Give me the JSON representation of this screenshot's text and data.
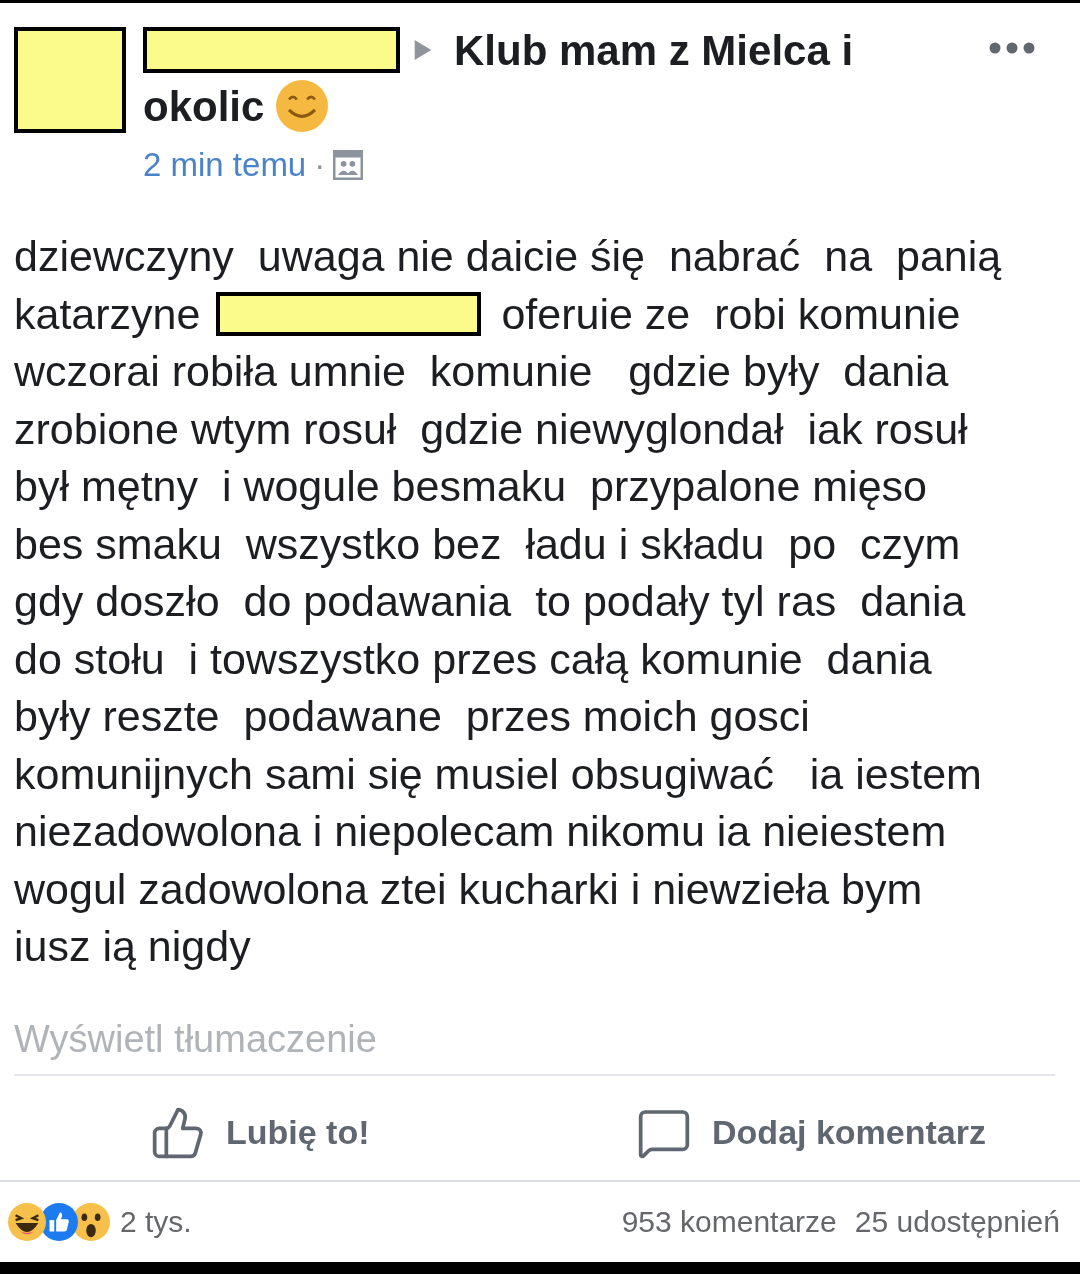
{
  "post": {
    "group_name_lines": [
      "Klub mam z Mielca i",
      "okolic"
    ],
    "timestamp": "2 min temu",
    "separator": "·",
    "body_lines": [
      {
        "kind": "text",
        "text": "dziewczyny  uwaga nie daicie śię  nabrać  na  panią"
      },
      {
        "kind": "redacted",
        "before": "katarzyne",
        "after": "oferuie ze  robi komunie"
      },
      {
        "kind": "text",
        "text": "wczorai robiła umnie  komunie   gdzie były  dania"
      },
      {
        "kind": "text",
        "text": "zrobione wtym rosuł  gdzie niewyglondał  iak rosuł"
      },
      {
        "kind": "text",
        "text": "był mętny  i wogule besmaku  przypalone mięso"
      },
      {
        "kind": "text",
        "text": "bes smaku  wszystko bez  ładu i składu  po  czym"
      },
      {
        "kind": "text",
        "text": "gdy doszło  do podawania  to podały tyl ras  dania"
      },
      {
        "kind": "text",
        "text": "do stołu  i towszystko przes całą komunie  dania"
      },
      {
        "kind": "text",
        "text": "były reszte  podawane  przes moich gosci"
      },
      {
        "kind": "text",
        "text": "komunijnych sami się musiel obsugiwać   ia iestem"
      },
      {
        "kind": "text",
        "text": "niezadowolona i niepolecam nikomu ia nieiestem"
      },
      {
        "kind": "text",
        "text": "wogul zadowolona ztei kucharki i niewzieła bym"
      },
      {
        "kind": "text",
        "text": "iusz ią nigdy"
      }
    ],
    "translate_link": "Wyświetl tłumaczenie",
    "actions": [
      {
        "kind": "like",
        "label": "Lubię to!"
      },
      {
        "kind": "comment",
        "label": "Dodaj komentarz"
      }
    ],
    "reactions": [
      {
        "kind": "haha"
      },
      {
        "kind": "like"
      },
      {
        "kind": "wow"
      }
    ],
    "reaction_count": "2 tys.",
    "comment_count": "953 komentarze",
    "share_count": "25 udostępnień"
  }
}
